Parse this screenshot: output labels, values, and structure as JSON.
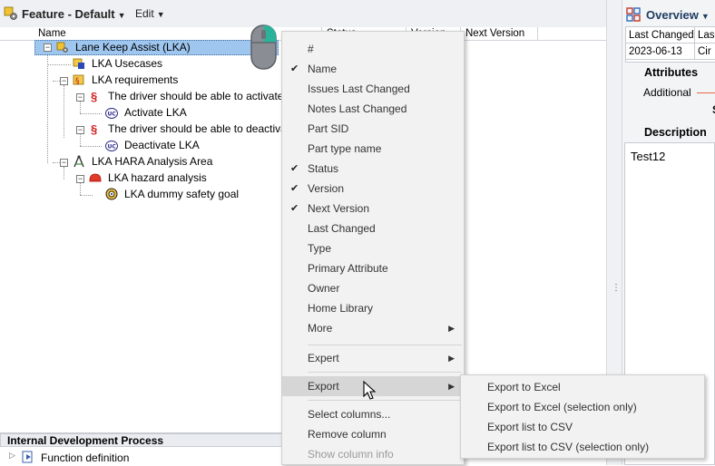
{
  "header": {
    "title": "Feature - Default",
    "edit_menu": "Edit"
  },
  "columns": {
    "name": "Name",
    "status": "Status",
    "version": "Version",
    "next_version": "Next Version"
  },
  "tree": {
    "root": "Lane Keep Assist (LKA)",
    "usecases": "LKA Usecases",
    "requirements": "LKA requirements",
    "req1": "The driver should be able to activate",
    "uc1": "Activate LKA",
    "req2": "The driver should be able to deactiva",
    "uc2": "Deactivate LKA",
    "hara": "LKA HARA Analysis Area",
    "hazard": "LKA hazard analysis",
    "goal": "LKA dummy safety goal"
  },
  "bottom_panel": {
    "title": "Internal Development Process",
    "item": "Function definition"
  },
  "overview": {
    "title": "Overview",
    "table_headers": [
      "Last Changed",
      "Las"
    ],
    "table_values": [
      "2023-06-13",
      "Cir"
    ],
    "attributes_label": "Attributes",
    "additional_label": "Additional",
    "s_label": "S",
    "description_label": "Description",
    "description_text": "Test12"
  },
  "context_menu": {
    "items": [
      {
        "label": "#",
        "checked": false
      },
      {
        "label": "Name",
        "checked": true
      },
      {
        "label": "Issues Last Changed",
        "checked": false
      },
      {
        "label": "Notes Last Changed",
        "checked": false
      },
      {
        "label": "Part SID",
        "checked": false
      },
      {
        "label": "Part type name",
        "checked": false
      },
      {
        "label": "Status",
        "checked": true
      },
      {
        "label": "Version",
        "checked": true
      },
      {
        "label": "Next Version",
        "checked": true
      },
      {
        "label": "Last Changed",
        "checked": false
      },
      {
        "label": "Type",
        "checked": false
      },
      {
        "label": "Primary Attribute",
        "checked": false
      },
      {
        "label": "Owner",
        "checked": false
      },
      {
        "label": "Home Library",
        "checked": false
      },
      {
        "label": "More",
        "checked": false
      }
    ],
    "expert": "Expert",
    "export": "Export",
    "select_columns": "Select columns...",
    "remove_column": "Remove column",
    "show_column_info": "Show column info"
  },
  "export_submenu": {
    "items": [
      "Export to Excel",
      "Export to Excel (selection only)",
      "Export list to CSV",
      "Export list to CSV (selection only)"
    ]
  },
  "colors": {
    "selection": "#9fc6ef",
    "menu_bg": "#f2f2f2",
    "menu_highlight": "#d6d6d6",
    "accent_red": "#d21e1e",
    "overview_title": "#1f3d63"
  }
}
